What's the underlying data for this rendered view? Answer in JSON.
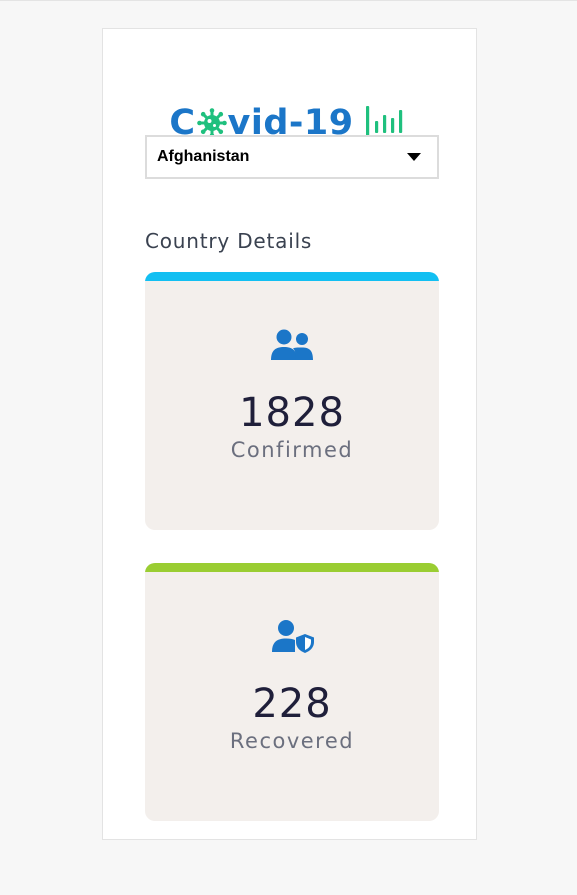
{
  "app": {
    "title_prefix": "C",
    "title_suffix": "vid-19",
    "logo_icon": "virus-icon",
    "chart_icon": "bar-chart-icon",
    "title_color": "#1b76c8",
    "accent_green": "#1fc07e"
  },
  "country_select": {
    "selected": "Afghanistan"
  },
  "section": {
    "title": "Country Details"
  },
  "cards": [
    {
      "key": "confirmed",
      "count": "1828",
      "label": "Confirmed",
      "bar_color": "#12bff2",
      "icon": "users-icon"
    },
    {
      "key": "recovered",
      "count": "228",
      "label": "Recovered",
      "bar_color": "#9acd32",
      "icon": "user-shield-icon"
    }
  ]
}
